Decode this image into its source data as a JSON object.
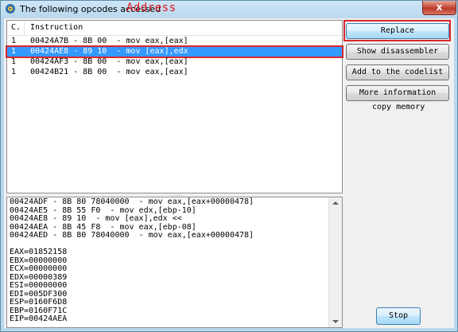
{
  "window": {
    "title": "The following opcodes accessed",
    "title_annotation": "Address",
    "close_label": "x"
  },
  "list": {
    "headers": {
      "count": "C.",
      "instruction": "Instruction"
    },
    "rows": [
      {
        "count": "1",
        "instruction": "00424A7B - 8B 00  - mov eax,[eax]",
        "selected": false
      },
      {
        "count": "1",
        "instruction": "00424AE8 - 89 10  - mov [eax],edx",
        "selected": true
      },
      {
        "count": "1",
        "instruction": "00424AF3 - 8B 00  - mov eax,[eax]",
        "selected": false
      },
      {
        "count": "1",
        "instruction": "00424B21 - 8B 00  - mov eax,[eax]",
        "selected": false
      }
    ]
  },
  "details": {
    "text": "00424ADF - 8B 80 78040000  - mov eax,[eax+00000478]\n00424AE5 - 8B 55 F0  - mov edx,[ebp-10]\n00424AE8 - 89 10  - mov [eax],edx <<\n00424AEA - 8B 45 F8  - mov eax,[ebp-08]\n00424AED - 8B 80 78040000  - mov eax,[eax+00000478]\n\nEAX=01852158\nEBX=00000000\nECX=00000000\nEDX=00000389\nESI=00000000\nEDI=005DF300\nESP=0160F6D8\nEBP=0160F71C\nEIP=00424AEA"
  },
  "buttons": {
    "replace": "Replace",
    "show_disassembler": "Show disassembler",
    "add_to_codelist": "Add to the codelist",
    "more_information": "More information",
    "copy_memory": "copy memory",
    "stop": "Stop"
  },
  "colors": {
    "selection": "#3399ff",
    "highlight_box": "#d9262e",
    "annotation_text": "#e0141e"
  }
}
